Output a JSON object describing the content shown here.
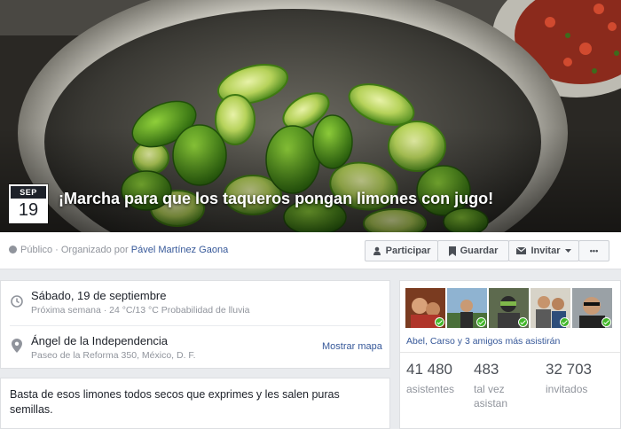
{
  "event": {
    "date_month": "SEP",
    "date_day": "19",
    "title": "¡Marcha para que los taqueros pongan limones con jugo!"
  },
  "header": {
    "privacy": "Público",
    "organized_by_prefix": "· Organizado por",
    "organizer": "Pável Martínez Gaona"
  },
  "actions": {
    "join_label": "Participar",
    "save_label": "Guardar",
    "invite_label": "Invitar",
    "more_label": "•••"
  },
  "details": {
    "date_line": "Sábado, 19 de septiembre",
    "date_sub": "Próxima semana · 24 °C/13 °C Probabilidad de lluvia",
    "place_name": "Ángel de la Independencia",
    "place_address": "Paseo de la Reforma 350, México, D. F.",
    "show_map_label": "Mostrar mapa",
    "description": "Basta de esos limones todos secos que exprimes y les salen puras semillas."
  },
  "guests": {
    "friends_going": "Abel, Carso y 3 amigos más asistirán",
    "going_count": "41 480",
    "going_label": "asistentes",
    "maybe_count": "483",
    "maybe_label_1": "tal vez",
    "maybe_label_2": "asistan",
    "invited_count": "32 703",
    "invited_label": "invitados"
  },
  "colors": {
    "link_blue": "#365899",
    "going_check": "#42b72a",
    "page_bg": "#e9ebee"
  }
}
